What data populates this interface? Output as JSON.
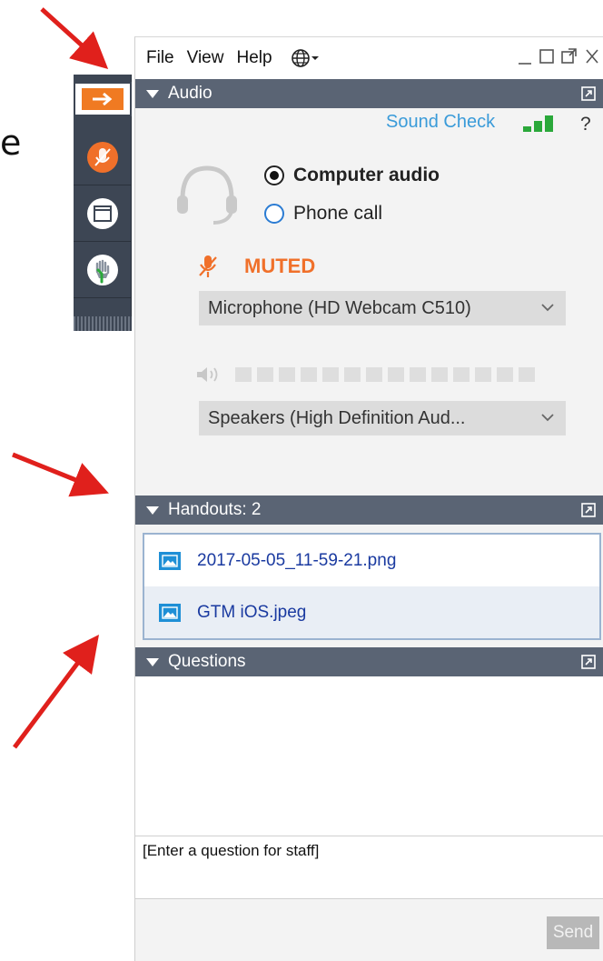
{
  "menubar": {
    "items": [
      "File",
      "View",
      "Help"
    ],
    "language_icon": "globe-icon",
    "window_controls": [
      "minimize-icon",
      "maximize-icon",
      "popout-icon",
      "close-icon"
    ]
  },
  "rail": {
    "buttons": [
      "collapse-arrow-icon",
      "microphone-muted-icon",
      "screen-icon",
      "raise-hand-icon"
    ]
  },
  "audio": {
    "header": "Audio",
    "sound_check": "Sound Check",
    "help": "?",
    "options": [
      {
        "label": "Computer audio",
        "selected": true
      },
      {
        "label": "Phone call",
        "selected": false
      }
    ],
    "mute_status": "MUTED",
    "microphone": "Microphone (HD Webcam C510)",
    "speakers": "Speakers (High Definition Aud..."
  },
  "handouts": {
    "header": "Handouts: 2",
    "files": [
      "2017-05-05_11-59-21.png",
      "GTM iOS.jpeg"
    ]
  },
  "questions": {
    "header": "Questions",
    "input_placeholder": "[Enter a question for staff]",
    "send_label": "Send"
  },
  "page_edge_text": "e",
  "colors": {
    "accent_orange": "#f0702a",
    "panel_header": "#5a6474",
    "rail": "#3d4654",
    "link_blue": "#3a9bd9",
    "arrow_red": "#e0201c",
    "signal_green": "#2aa83a"
  }
}
